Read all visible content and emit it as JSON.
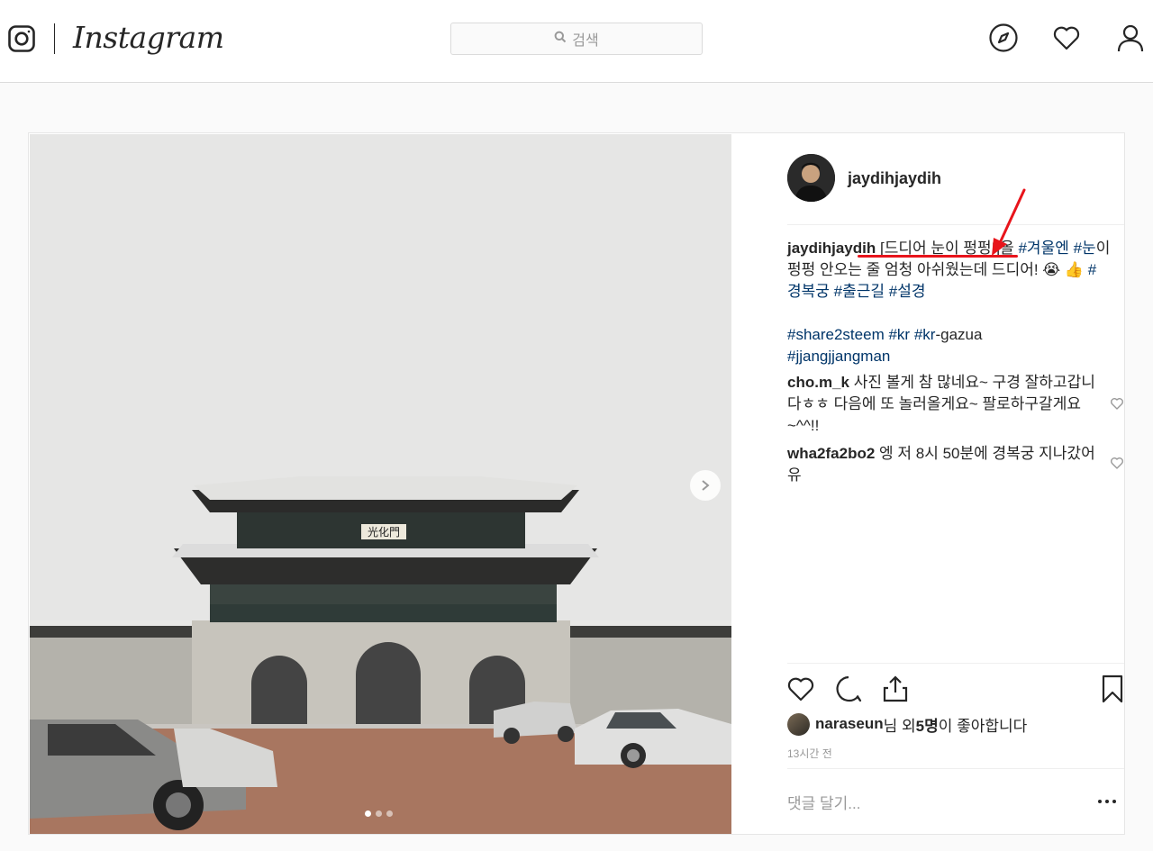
{
  "header": {
    "wordmark": "Instagram",
    "search_placeholder": "검색",
    "icons": [
      "instagram-glyph-icon",
      "compass-icon",
      "heart-icon",
      "profile-icon"
    ]
  },
  "post": {
    "owner": "jaydihjaydih",
    "photo": {
      "carousel_dots": 3,
      "active_dot": 0,
      "signboard": "光化門"
    },
    "caption": {
      "username": "jaydihjaydih",
      "highlight": "[드디어 눈이 펑펑!]",
      "text1": "올 ",
      "tag1": "#겨울엔",
      "tag2": "#눈",
      "text2": "이 펑펑 안오는 줄 엄청 아쉬웠는데 드디어! 😭 👍 ",
      "tag3": "#",
      "tag4": "경복궁",
      "tag5": "#출근길",
      "tag6": "#설경",
      "tag7": "#share2steem",
      "tag8": "#kr",
      "tag9": "#kr",
      "text3": "-gazua",
      "tag10": "#jjangjjangman"
    },
    "comments": [
      {
        "user": "cho.m_k",
        "text": "사진 볼게 참 많네요~ 구경 잘하고갑니다ㅎㅎ 다음에 또 놀러올게요~ 팔로하구갈게요~^^!!"
      },
      {
        "user": "wha2fa2bo2",
        "text": "엥 저 8시 50분에 경복궁 지나갔어유"
      }
    ],
    "likes": {
      "user": "naraseun",
      "suffix": "님 외 ",
      "count": "5명",
      "end": "이 좋아합니다"
    },
    "time": "13시간 전",
    "add_comment_placeholder": "댓글 달기..."
  },
  "colors": {
    "link": "#003569",
    "annotation_red": "#e8141b",
    "border": "#dbdbdb"
  }
}
